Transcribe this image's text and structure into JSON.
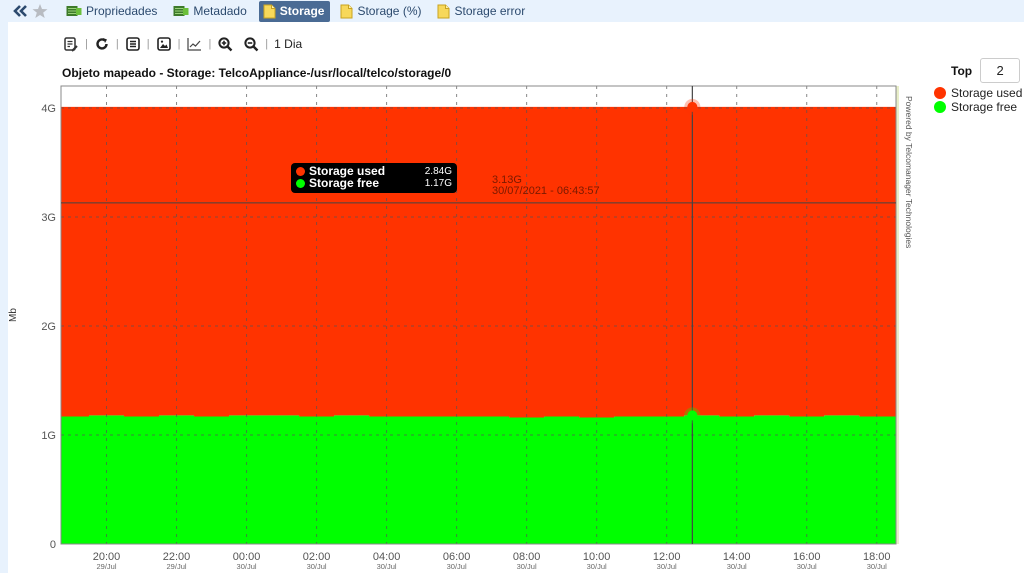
{
  "tabbar": {
    "nav": [
      {
        "name": "collapse-icon",
        "glyph": "«"
      },
      {
        "name": "favorite-star-icon",
        "glyph": "★"
      }
    ],
    "tabs": [
      {
        "label": "Propriedades",
        "icon": "properties-icon",
        "active": false
      },
      {
        "label": "Metadado",
        "icon": "metadata-icon",
        "active": false
      },
      {
        "label": "Storage",
        "icon": "document-icon",
        "active": true
      },
      {
        "label": "Storage (%)",
        "icon": "document-icon",
        "active": false
      },
      {
        "label": "Storage error",
        "icon": "document-icon",
        "active": false
      }
    ]
  },
  "toolbar": {
    "buttons": [
      "edit-report-icon",
      "refresh-icon",
      "list-view-icon",
      "image-export-icon",
      "line-chart-icon",
      "zoom-in-icon",
      "zoom-out-icon"
    ],
    "period_label": "1 Dia"
  },
  "top_control": {
    "label": "Top",
    "value": "2"
  },
  "legend": [
    {
      "label": "Storage used",
      "color": "#ff3300"
    },
    {
      "label": "Storage free",
      "color": "#00ff00"
    }
  ],
  "tooltip": {
    "rows": [
      {
        "name": "Storage used",
        "value": "2.84G",
        "color": "#ff3300"
      },
      {
        "name": "Storage free",
        "value": "1.17G",
        "color": "#00ff00"
      }
    ]
  },
  "crosshair": {
    "value_label": "3.13G",
    "time_label": "30/07/2021 - 06:43:57",
    "value": 3.13,
    "time_hours": 36.733
  },
  "chart_data": {
    "type": "area",
    "stacked": true,
    "title": "Objeto mapeado - Storage: TelcoAppliance-/usr/local/telco/storage/0",
    "ylabel": "Mb",
    "xlabel": "",
    "watermark": "Powered by Telcomanager Technologies",
    "ylim": [
      0,
      4.2
    ],
    "yticks": [
      {
        "value": 0,
        "label": "0"
      },
      {
        "value": 1,
        "label": "1G"
      },
      {
        "value": 2,
        "label": "2G"
      },
      {
        "value": 3,
        "label": "3G"
      },
      {
        "value": 4,
        "label": "4G"
      }
    ],
    "x_unit": "hours since 29/Jul 00:00",
    "xlim": [
      18.7,
      42.55
    ],
    "xticks": [
      {
        "value": 20,
        "time": "20:00",
        "date": "29/Jul"
      },
      {
        "value": 22,
        "time": "22:00",
        "date": "29/Jul"
      },
      {
        "value": 24,
        "time": "00:00",
        "date": "30/Jul"
      },
      {
        "value": 26,
        "time": "02:00",
        "date": "30/Jul"
      },
      {
        "value": 28,
        "time": "04:00",
        "date": "30/Jul"
      },
      {
        "value": 30,
        "time": "06:00",
        "date": "30/Jul"
      },
      {
        "value": 32,
        "time": "08:00",
        "date": "30/Jul"
      },
      {
        "value": 34,
        "time": "10:00",
        "date": "30/Jul"
      },
      {
        "value": 36,
        "time": "12:00",
        "date": "30/Jul"
      },
      {
        "value": 38,
        "time": "14:00",
        "date": "30/Jul"
      },
      {
        "value": 40,
        "time": "16:00",
        "date": "30/Jul"
      },
      {
        "value": 42,
        "time": "18:00",
        "date": "30/Jul"
      }
    ],
    "grid": true,
    "legend_position": "right",
    "x": [
      18.7,
      19.5,
      20.5,
      21.5,
      22.5,
      23.5,
      24.5,
      25.5,
      26.5,
      27.5,
      28.5,
      29.5,
      30.5,
      31.5,
      32.5,
      33.5,
      34.5,
      35.5,
      36.5,
      37.5,
      38.5,
      39.5,
      40.5,
      41.5,
      42.55
    ],
    "series": [
      {
        "name": "Storage free",
        "color": "#00ff00",
        "values": [
          1.17,
          1.18,
          1.17,
          1.18,
          1.17,
          1.18,
          1.18,
          1.17,
          1.18,
          1.17,
          1.17,
          1.17,
          1.17,
          1.16,
          1.17,
          1.16,
          1.17,
          1.17,
          1.18,
          1.17,
          1.18,
          1.17,
          1.18,
          1.17,
          1.17
        ]
      },
      {
        "name": "Storage used",
        "color": "#ff3300",
        "values": [
          2.84,
          2.83,
          2.84,
          2.83,
          2.84,
          2.83,
          2.83,
          2.84,
          2.83,
          2.84,
          2.84,
          2.84,
          2.84,
          2.85,
          2.84,
          2.85,
          2.84,
          2.84,
          2.83,
          2.84,
          2.83,
          2.84,
          2.83,
          2.84,
          2.84
        ]
      }
    ]
  }
}
